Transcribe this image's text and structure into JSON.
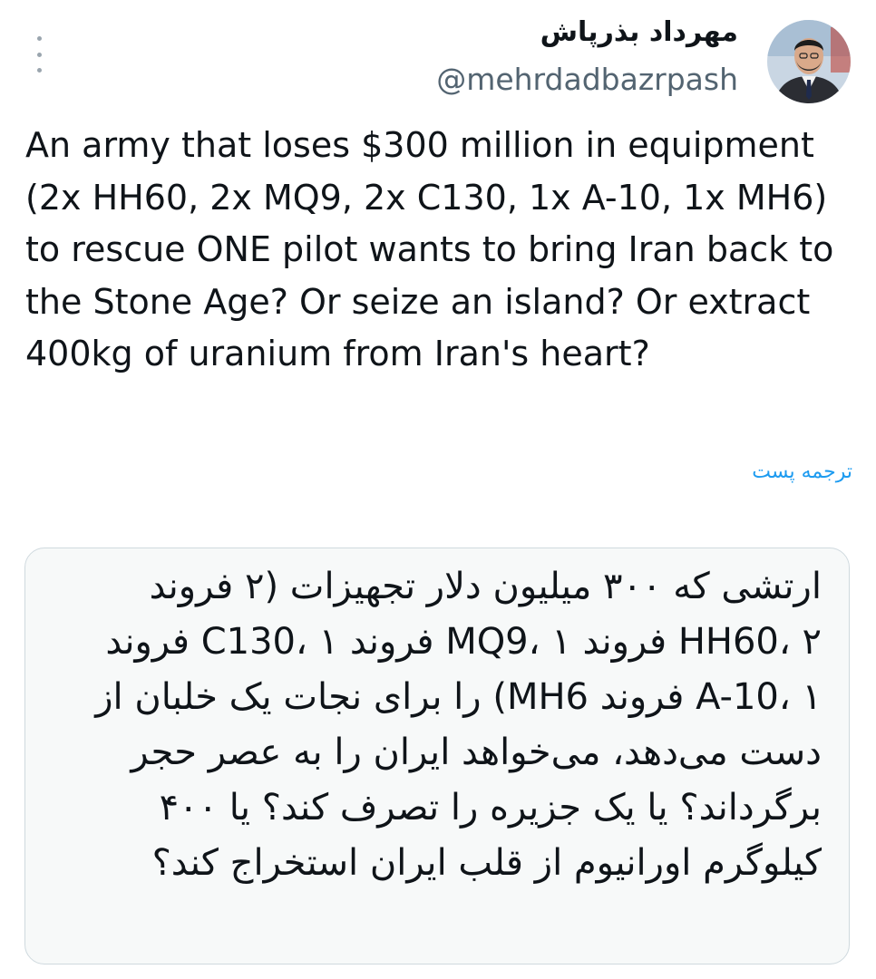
{
  "tweet": {
    "author": {
      "display_name": "مهرداد بذرپاش",
      "handle": "@mehrdadbazrpash"
    },
    "text": "An army that loses $300 million in equipment (2x HH60, 2x MQ9, 2x C130, 1x A-10, 1x MH6) to rescue ONE pilot wants to bring Iran back to the Stone Age? Or seize an island? Or extract 400kg of uranium from Iran's heart?",
    "translate_label": "ترجمه پست",
    "translation": "ارتشی که ۳۰۰ میلیون دلار تجهیزات (۲ فروند HH60، ۲ فروند MQ9، ۱ فروند C130، ۱ فروند A-10، ۱ فروند MH6) را برای نجات یک خلبان از دست می‌دهد، می‌خواهد ایران را به عصر حجر برگرداند؟ یا یک جزیره را تصرف کند؟ یا ۴۰۰ کیلوگرم اورانیوم از قلب ایران استخراج کند؟"
  },
  "icons": {
    "more": "more-vertical-icon"
  },
  "colors": {
    "text": "#0f1419",
    "secondary": "#536471",
    "link": "#1d9bf0",
    "card_border": "#cfd9de",
    "card_background": "#f7f9f9"
  }
}
